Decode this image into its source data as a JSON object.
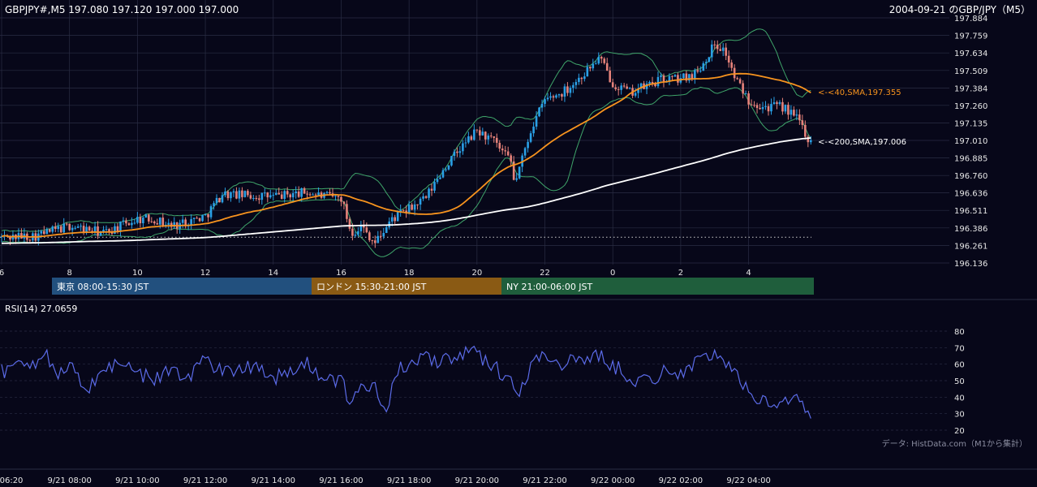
{
  "header": {
    "symbol_info": "GBPJPY#,M5 197.080 197.120 197.000 197.000",
    "title": "2004-09-21 のGBP/JPY（M5）"
  },
  "colors": {
    "background": "#070719",
    "bull": "#2aa0e6",
    "bear": "#e6827a",
    "sma40": "#f7931e",
    "sma200": "#ffffff",
    "bollinger": "#3fa56a",
    "rsi": "#5b6be8",
    "grid": "#2a2d44",
    "session_tokyo": "#22507e",
    "session_london": "#8a5a14",
    "session_ny": "#1f5e3c"
  },
  "chart_data": [
    {
      "type": "candlestick",
      "title": "GBPJPY#,M5",
      "y_ticks": [
        "197.884",
        "197.759",
        "197.634",
        "197.509",
        "197.384",
        "197.260",
        "197.135",
        "197.010",
        "196.885",
        "196.760",
        "196.636",
        "196.511",
        "196.386",
        "196.261",
        "196.136"
      ],
      "ylim": [
        196.136,
        197.884
      ],
      "x_ticks": [
        "6",
        "8",
        "10",
        "12",
        "14",
        "16",
        "18",
        "20",
        "22",
        "0",
        "2",
        "4"
      ],
      "price_anchors": {
        "hours": [
          6.0,
          7.0,
          8.0,
          9.0,
          10.0,
          10.5,
          11.0,
          12.0,
          12.5,
          13.0,
          14.0,
          15.0,
          15.5,
          16.0,
          16.3,
          16.6,
          17.0,
          17.5,
          18.0,
          18.5,
          19.0,
          19.5,
          20.0,
          20.5,
          21.0,
          21.1,
          21.3,
          21.6,
          22.0,
          22.5,
          23.0,
          23.6,
          24.0,
          24.5,
          25.0,
          25.5,
          26.0,
          26.5,
          27.0,
          27.3,
          27.6,
          28.0,
          28.5,
          29.0,
          29.5,
          29.8
        ],
        "closes": [
          196.32,
          196.33,
          196.4,
          196.35,
          196.45,
          196.45,
          196.4,
          196.47,
          196.63,
          196.62,
          196.61,
          196.64,
          196.61,
          196.6,
          196.35,
          196.4,
          196.28,
          196.45,
          196.52,
          196.6,
          196.8,
          196.95,
          197.08,
          197.0,
          196.85,
          196.7,
          196.85,
          197.1,
          197.3,
          197.35,
          197.45,
          197.6,
          197.42,
          197.35,
          197.4,
          197.45,
          197.45,
          197.5,
          197.7,
          197.65,
          197.45,
          197.3,
          197.25,
          197.25,
          197.15,
          197.0
        ]
      },
      "sma40": {
        "label": "<-<40,SMA,197.355",
        "value": 197.355
      },
      "sma200": {
        "label": "<-<200,SMA,197.006",
        "value": 197.006
      },
      "dotted_level": 196.32
    },
    {
      "type": "line",
      "title": "RSI(14) 27.0659",
      "y_ticks": [
        "80",
        "70",
        "60",
        "50",
        "40",
        "30",
        "20"
      ],
      "ylim": [
        20,
        80
      ],
      "x_ticks": [
        "06:20",
        "9/21 08:00",
        "9/21 10:00",
        "9/21 12:00",
        "9/21 14:00",
        "9/21 16:00",
        "9/21 18:00",
        "9/21 20:00",
        "9/21 22:00",
        "9/22 00:00",
        "9/22 02:00",
        "9/22 04:00"
      ],
      "rsi_anchors": {
        "hours": [
          6.0,
          6.5,
          7.0,
          7.3,
          7.6,
          8.0,
          8.5,
          9.0,
          9.5,
          10.0,
          10.5,
          11.0,
          11.5,
          12.0,
          12.5,
          13.0,
          13.5,
          14.0,
          14.5,
          15.0,
          15.5,
          16.0,
          16.3,
          16.6,
          17.0,
          17.3,
          17.6,
          18.0,
          18.5,
          19.0,
          19.5,
          20.0,
          20.5,
          21.0,
          21.2,
          21.5,
          22.0,
          22.5,
          23.0,
          23.5,
          24.0,
          24.5,
          25.0,
          25.5,
          26.0,
          26.5,
          27.0,
          27.3,
          27.6,
          28.0,
          28.5,
          29.0,
          29.5,
          29.8
        ],
        "values": [
          55,
          60,
          62,
          70,
          50,
          58,
          45,
          56,
          62,
          55,
          50,
          58,
          52,
          64,
          55,
          58,
          60,
          52,
          55,
          60,
          52,
          50,
          34,
          45,
          50,
          30,
          55,
          60,
          63,
          62,
          66,
          66,
          58,
          52,
          38,
          56,
          68,
          60,
          62,
          66,
          60,
          52,
          50,
          55,
          56,
          60,
          68,
          60,
          54,
          45,
          36,
          38,
          40,
          27
        ]
      },
      "value_label": "27.0659"
    }
  ],
  "sessions": [
    {
      "label": "東京 08:00-15:30 JST"
    },
    {
      "label": "ロンドン 15:30-21:00 JST"
    },
    {
      "label": "NY 21:00-06:00 JST"
    }
  ],
  "source_note": "データ: HistData.com（M1から集計）"
}
